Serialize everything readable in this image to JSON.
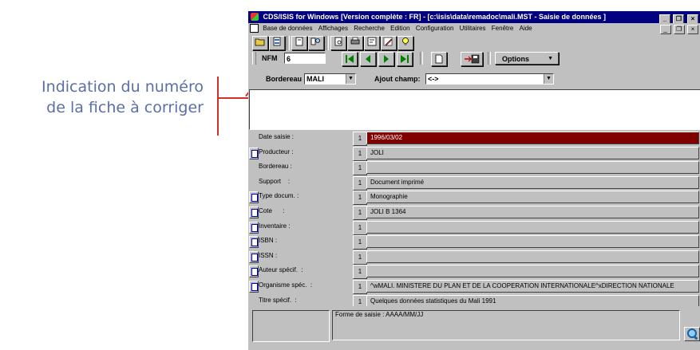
{
  "annotation": {
    "line1": "Indication du numéro",
    "line2": "de la fiche à corriger"
  },
  "window": {
    "title": "CDS/ISIS for Windows [Version complète : FR] - [c:\\isis\\data\\remadoc\\mali.MST - Saisie de données ]",
    "controls": [
      "_",
      "❐",
      "×"
    ]
  },
  "menu": {
    "items": [
      "Base de données",
      "Affichages",
      "Recherche",
      "Edition",
      "Configuration",
      "Utilitaires",
      "Fenêtre",
      "Aide"
    ],
    "child_controls": [
      "_",
      "❐",
      "×"
    ]
  },
  "toolbar": {
    "icons": [
      "open-folder-icon",
      "database-icon",
      "record-icon",
      "search-icon",
      "display-icon",
      "print-icon",
      "edit-icon",
      "pencil-icon",
      "lightbulb-icon"
    ]
  },
  "nav": {
    "nfm_label": "NFM",
    "nfm_value": "6",
    "options_label": "Options",
    "buttons": [
      "first-record",
      "previous-record",
      "next-record",
      "last-record",
      "new-record",
      "save-record"
    ]
  },
  "bordereau": {
    "label": "Bordereau",
    "value": "MALI",
    "ajout_label": "Ajout champ:",
    "ajout_value": "<->"
  },
  "fields": [
    {
      "label": "Date saisie :",
      "occ": "1",
      "value": "1996/03/02",
      "has_button": false,
      "selected": true
    },
    {
      "label": "Producteur :",
      "occ": "1",
      "value": "JOLI",
      "has_button": true,
      "selected": false
    },
    {
      "label": "Bordereau :",
      "occ": "1",
      "value": "",
      "has_button": false,
      "selected": false
    },
    {
      "label": "Support    :",
      "occ": "1",
      "value": "Document imprimé",
      "has_button": false,
      "selected": false
    },
    {
      "label": "Type docum. :",
      "occ": "1",
      "value": "Monographie",
      "has_button": true,
      "selected": false
    },
    {
      "label": "Cote      :",
      "occ": "1",
      "value": "JOLI B 1364",
      "has_button": true,
      "selected": false
    },
    {
      "label": "Inventaire :",
      "occ": "1",
      "value": "",
      "has_button": true,
      "selected": false
    },
    {
      "label": "ISBN :",
      "occ": "1",
      "value": "",
      "has_button": true,
      "selected": false
    },
    {
      "label": "ISSN :",
      "occ": "1",
      "value": "",
      "has_button": true,
      "selected": false
    },
    {
      "label": "Auteur spécif.  :",
      "occ": "1",
      "value": "",
      "has_button": true,
      "selected": false
    },
    {
      "label": "Organisme spéc.  :",
      "occ": "1",
      "value": "^wMALI. MINISTERE DU PLAN ET DE LA COOPERATION INTERNATIONALE^xDIRECTION NATIONALE",
      "has_button": true,
      "selected": false
    },
    {
      "label": "Titre spécif.  :",
      "occ": "1",
      "value": "Quelques données statistiques du Mali 1991",
      "has_button": false,
      "selected": false
    }
  ],
  "status": {
    "hint": "Forme de saisie : AAAA/MM/JJ"
  }
}
